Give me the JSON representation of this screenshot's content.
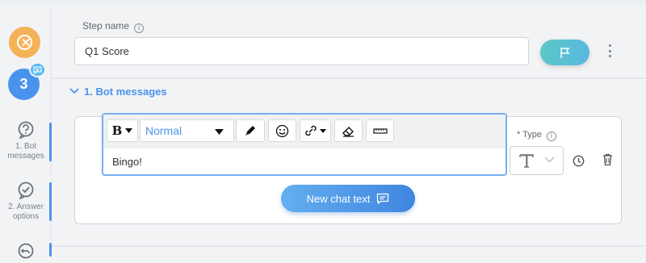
{
  "sidebar": {
    "step_number": "3",
    "items": [
      {
        "label_line1": "1. Bot",
        "label_line2": "messages",
        "icon": "question-bubble-icon"
      },
      {
        "label_line1": "2. Answer",
        "label_line2": "options",
        "icon": "check-circle-icon"
      },
      {
        "label_line1": "",
        "label_line2": "",
        "icon": "undo-icon"
      }
    ],
    "accent": "#4a93ec",
    "close_color": "#f4b257"
  },
  "step": {
    "label": "Step name",
    "value": "Q1 Score"
  },
  "section": {
    "title": "1. Bot messages"
  },
  "editor": {
    "bold_label": "B",
    "format_value": "Normal",
    "text": "Bingo!"
  },
  "type": {
    "label": "* Type",
    "value_icon": "text-type-icon"
  },
  "chat_button": {
    "label": "New chat text"
  }
}
